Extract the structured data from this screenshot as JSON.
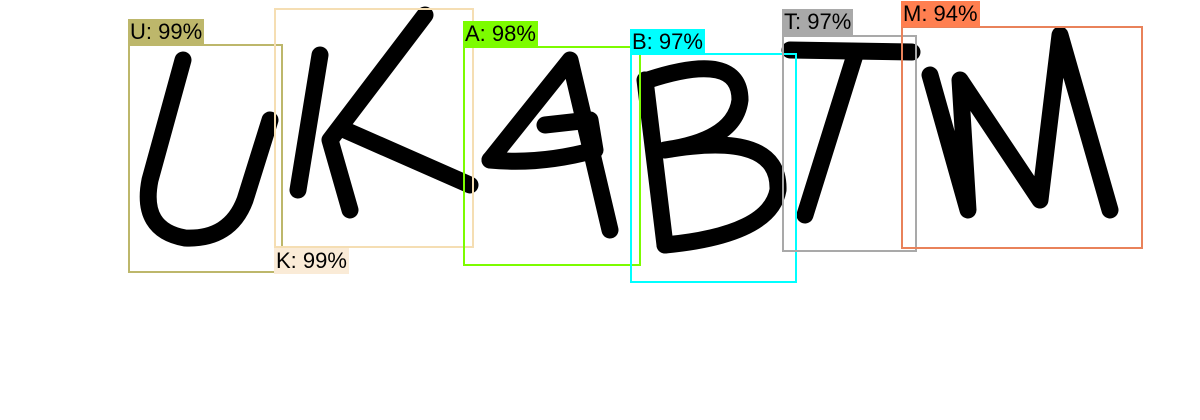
{
  "captcha_text": "UKABTM",
  "detections": [
    {
      "label": "U: 99%",
      "color": "#bdb76b",
      "label_bg": "#bdb76b"
    },
    {
      "label": "K: 99%",
      "color": "#f5deb3",
      "label_bg": "#faebd7"
    },
    {
      "label": "A: 98%",
      "color": "#7cfc00",
      "label_bg": "#7cfc00"
    },
    {
      "label": "B: 97%",
      "color": "#00ffff",
      "label_bg": "#00ffff"
    },
    {
      "label": "T: 97%",
      "color": "#a9a9a9",
      "label_bg": "#a9a9a9"
    },
    {
      "label": "M: 94%",
      "color": "#e9825a",
      "label_bg": "#ff7f50"
    }
  ]
}
